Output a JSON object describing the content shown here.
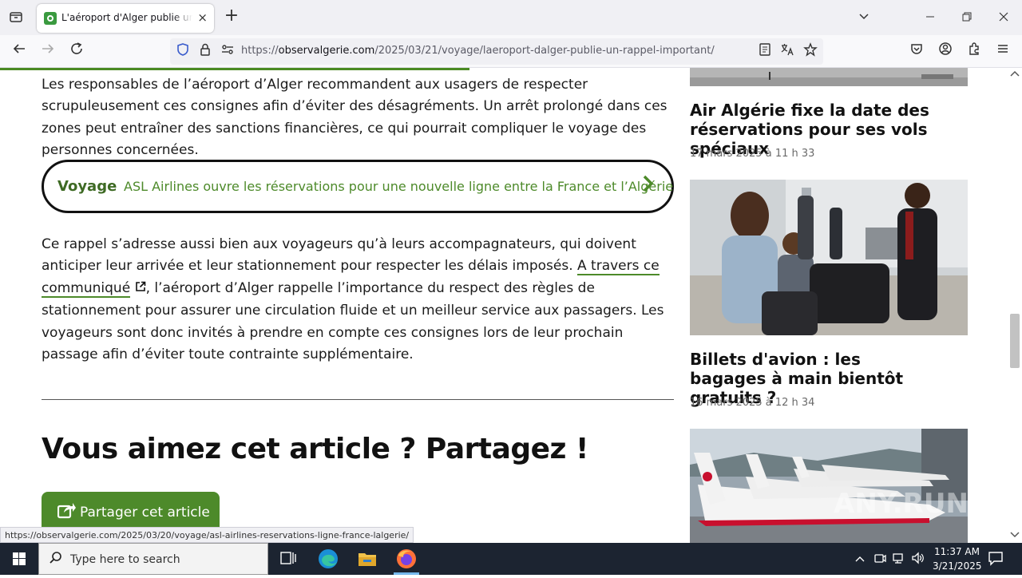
{
  "browser": {
    "tab_title": "L'aéroport d'Alger publie un rappel important",
    "tab_close": "×",
    "new_tab": "+",
    "url_prefix": "https://",
    "url_domain": "observalgerie.com",
    "url_path": "/2025/03/21/voyage/laeroport-dalger-publie-un-rappel-important/",
    "status_url": "https://observalgerie.com/2025/03/20/voyage/asl-airlines-reservations-ligne-france-lalgerie/"
  },
  "article": {
    "para1": "Les responsables de l’aéroport d’Alger recommandent aux usagers de respecter scrupuleusement ces consignes afin d’éviter des désagréments. Un arrêt prolongé dans ces zones peut entraîner des sanctions financières, ce qui pourrait compliquer le voyage des personnes concernées.",
    "related": {
      "category": "Voyage",
      "title": "ASL Airlines ouvre les réservations pour une nouvelle ligne entre la France et l’Algérie",
      "arrow": "›"
    },
    "para2_before": "Ce rappel s’adresse aussi bien aux voyageurs qu’à leurs accompagnateurs, qui doivent anticiper leur arrivée et leur stationnement pour respecter les délais imposés. ",
    "para2_link": "A travers ce communiqué",
    "para2_after": ", l’aéroport d’Alger rappelle l’importance du respect des règles de stationnement pour assurer une circulation fluide et un meilleur service aux passagers. Les voyageurs sont donc invités à prendre en compte ces consignes lors de leur prochain passage afin d’éviter toute contrainte supplémentaire.",
    "share_heading": "Vous aimez cet article ? Partagez !",
    "share_button": "Partager cet article"
  },
  "sidebar": {
    "items": [
      {
        "title": "Air Algérie fixe la date des réservations pour ses vols spéciaux",
        "date": "17 mars 2025 à 11 h 33"
      },
      {
        "title": "Billets d'avion : les bagages à main bientôt gratuits ?",
        "date": "16 mars 2025 à 12 h 34"
      }
    ]
  },
  "taskbar": {
    "search_placeholder": "Type here to search",
    "time": "11:37 AM",
    "date": "3/21/2025"
  },
  "watermark": "ANY.RUN",
  "colors": {
    "accent_green": "#4d8a2a",
    "taskbar": "#1c2431"
  }
}
